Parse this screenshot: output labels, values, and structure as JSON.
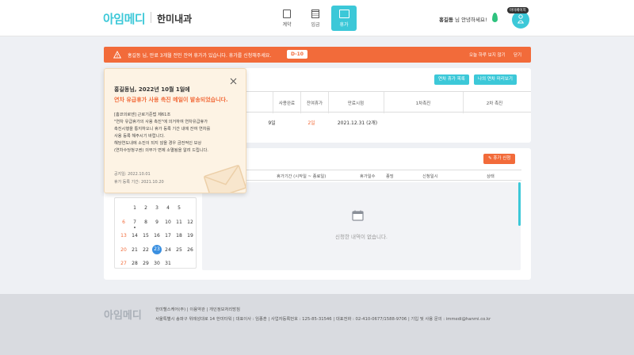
{
  "header": {
    "logo": "아임메디",
    "logo_sub": "한미내과",
    "nav": [
      {
        "label": "계약",
        "icon": "document-icon"
      },
      {
        "label": "임금",
        "icon": "calculator-icon"
      },
      {
        "label": "휴가",
        "icon": "vacation-icon",
        "active": true
      }
    ],
    "user_name": "홍길동",
    "greeting": "님 안녕하세요!",
    "avatar_badge": "마이페이지"
  },
  "alert": {
    "text": "홍길동 님, 만료 3개월 전인 잔여 휴가가 있습니다.  휴가를 신청해주세요.",
    "badge": "D-10",
    "option": "오늘 하루 보지 않기",
    "close": "닫기"
  },
  "leave_summary": {
    "btn_history": "연차 휴가 목록",
    "btn_promo": "나의 연차 미리보기",
    "columns": [
      "사용완료",
      "잔여휴가",
      "만료시점",
      "1차촉진",
      "2차 촉진"
    ],
    "row": {
      "used": "9일",
      "remaining": "2일",
      "expiry": "2021.12.31 (2개)"
    }
  },
  "requests": {
    "btn_apply": "휴가 신청",
    "columns": [
      "휴가기간 (시작일 ~ 종료일)",
      "휴가일수",
      "종빙",
      "신청일시",
      "상태"
    ],
    "empty_text": "신청한 내역이 없습니다."
  },
  "calendar": {
    "rows": [
      [
        "",
        "1",
        "2",
        "3",
        "4",
        "5",
        ""
      ],
      [
        "6",
        "7",
        "8",
        "9",
        "10",
        "11",
        "12"
      ],
      [
        "13",
        "14",
        "15",
        "16",
        "17",
        "18",
        "19"
      ],
      [
        "20",
        "21",
        "22",
        "23",
        "24",
        "25",
        "26"
      ],
      [
        "27",
        "28",
        "29",
        "30",
        "31",
        "",
        ""
      ]
    ],
    "today": "23"
  },
  "popup": {
    "title1": "홍길동님, 2022년 10월 1일에",
    "title2": "연차 유급휴가 사용 촉진 메일이 발송되었습니다.",
    "body": [
      "[홈코의로엔] 근로기준법 제61조",
      "\"연차 유급휴가의 사용 촉진\"에 의거하여 연차유급휴가",
      "촉진시행을 통지하오니 휴가 등록 기간 내에 잔여 연차를",
      "사용 등록 해주시기 바랍니다.",
      "해당연도내에 소진이 되지 않을 경우 금전적인 보상",
      "(연차수당청구권) 의무가 면제 소멸됨을 알려 드립니다."
    ],
    "notice_date": "공지일: 2022.10.01",
    "register_period": "휴가 등록 기간: 2021.10.20"
  },
  "footer": {
    "logo": "아임메디",
    "links": "한미헬스케어(주)  |  이용약관  |  개인정보처리방침",
    "info": "서울특별시 송파구 위례성대로 14 한미타워  |  대표이사 : 임종훈  |  사업자등록번호 : 125-85-31546  |  대표전화 : 02-410-0677/1588-9706  |  기입 및 사용 문의 : immedi@hanmi.co.kr"
  },
  "colors": {
    "accent": "#3cc8d8",
    "warning": "#f26b3a",
    "popup_bg": "#fdf3e4"
  }
}
